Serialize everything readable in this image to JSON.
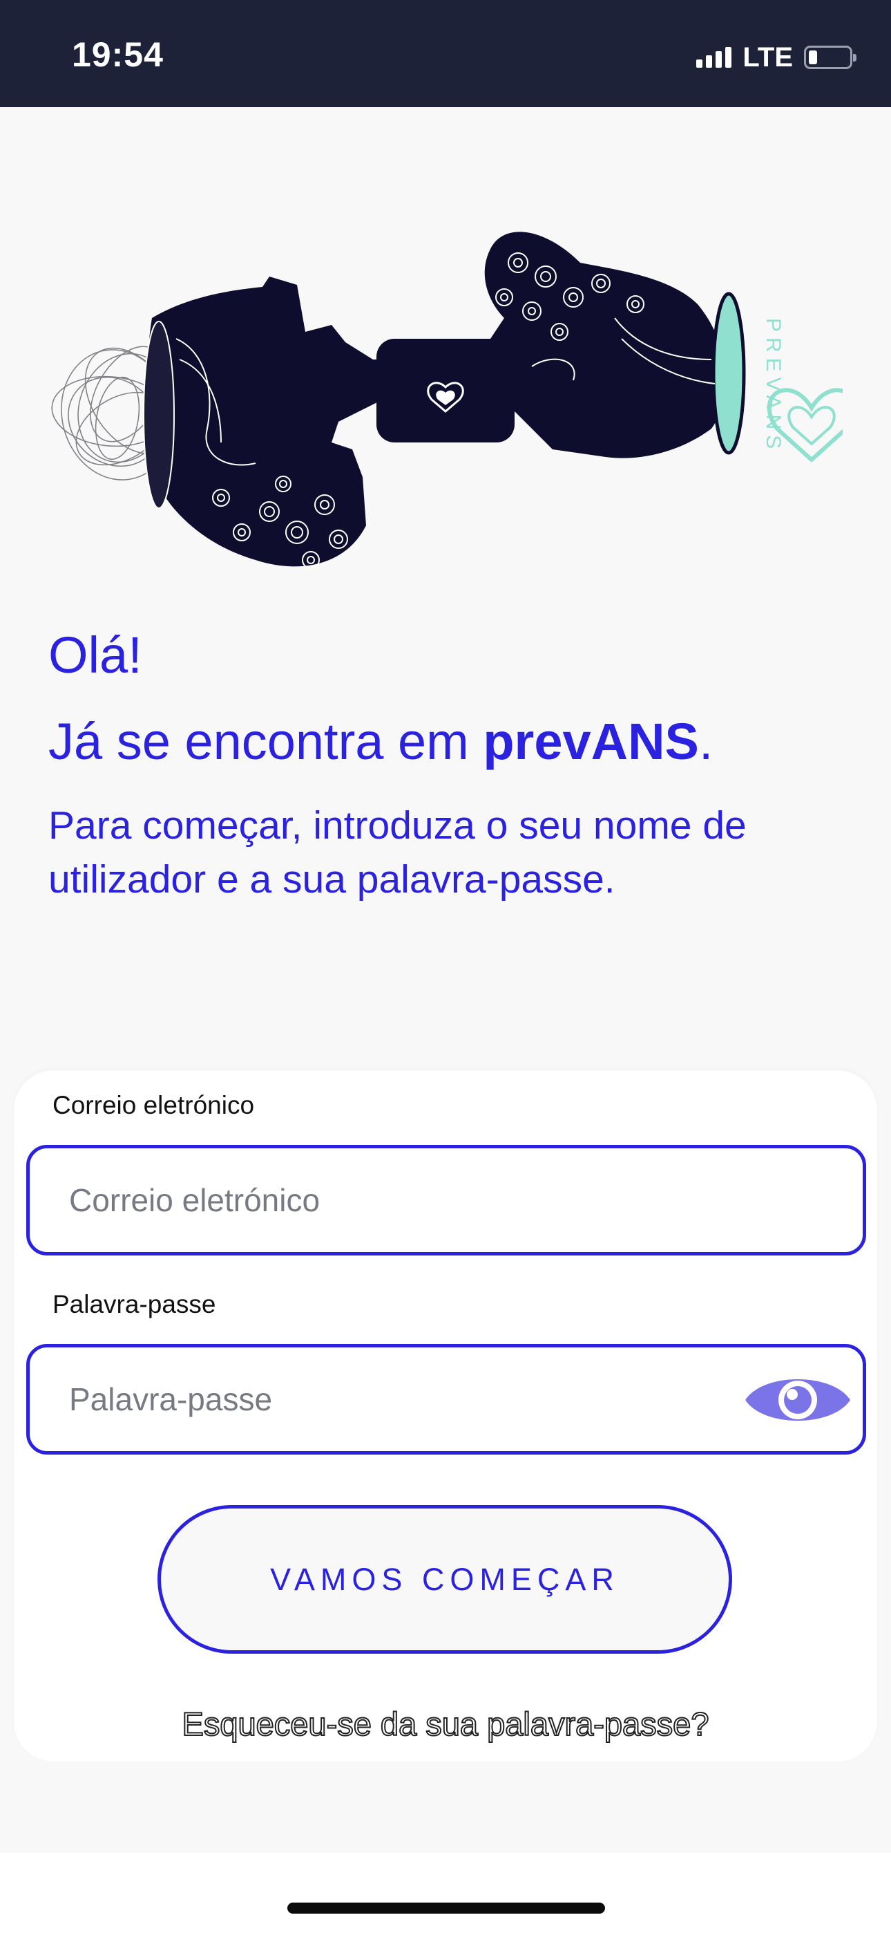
{
  "status_bar": {
    "time": "19:54",
    "network": "LTE",
    "icons": [
      "signal-icon",
      "battery-icon"
    ]
  },
  "illustration": {
    "logo_text": "PREVANS",
    "colors": {
      "dark": "#0f0d2e",
      "accent": "#8fe0cf"
    }
  },
  "greeting": {
    "hello": "Olá!",
    "intro_prefix": "Já se encontra em ",
    "brand": "prevANS",
    "intro_suffix": ".",
    "instructions": "Para começar, introduza o seu nome de utilizador e a sua palavra-passe."
  },
  "form": {
    "email_label": "Correio eletrónico",
    "email_placeholder": "Correio eletrónico",
    "password_label": "Palavra-passe",
    "password_placeholder": "Palavra-passe",
    "toggle_icon": "eye-icon",
    "submit_label": "VAMOS COMEÇAR",
    "forgot_label": "Esqueceu-se da sua palavra-passe?"
  },
  "colors": {
    "primary": "#2b22e0",
    "status_bar_bg": "#1e2239",
    "eye_icon": "#7b74e8"
  }
}
